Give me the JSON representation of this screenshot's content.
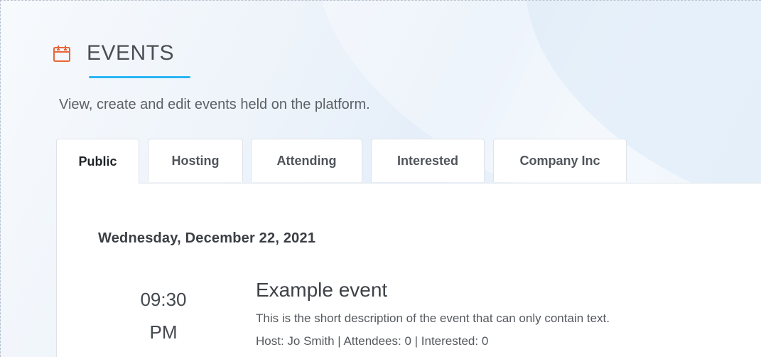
{
  "header": {
    "title": "EVENTS",
    "subtitle": "View, create and edit events held on the platform.",
    "icon": "calendar-icon",
    "accent_color": "#e8653a",
    "underline_color": "#29b6f6"
  },
  "tabs": [
    {
      "label": "Public",
      "active": true
    },
    {
      "label": "Hosting",
      "active": false
    },
    {
      "label": "Attending",
      "active": false
    },
    {
      "label": "Interested",
      "active": false
    },
    {
      "label": "Company Inc",
      "active": false
    }
  ],
  "events": {
    "date": "Wednesday, December 22, 2021",
    "items": [
      {
        "time_hm": "09:30",
        "time_ampm": "PM",
        "title": "Example event",
        "description": "This is the short description of the event that can only contain text.",
        "meta": "Host: Jo Smith | Attendees: 0 | Interested: 0"
      }
    ]
  }
}
